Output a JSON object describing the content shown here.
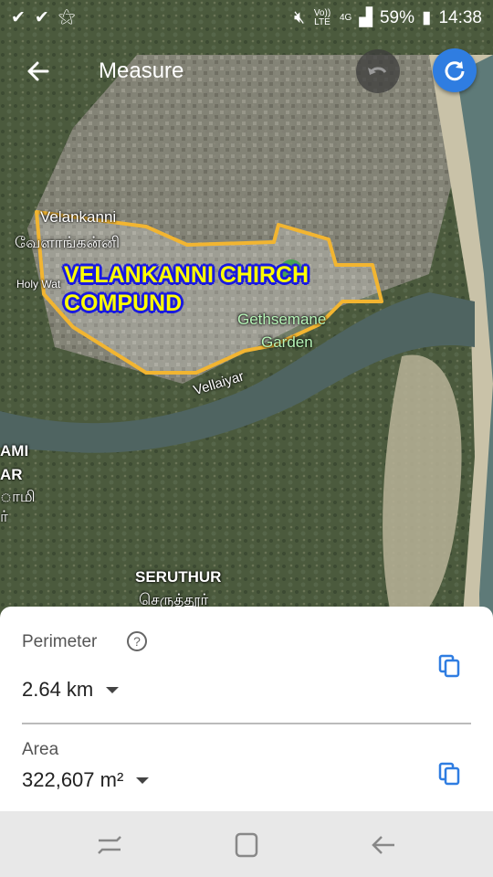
{
  "status_bar": {
    "volte_label": "Vo)) LTE",
    "network_label": "4G",
    "battery": "59%",
    "time": "14:38"
  },
  "app_bar": {
    "title": "Measure"
  },
  "map": {
    "labels": {
      "velankanni_en": "Velankanni",
      "velankanni_ta": "வேளாங்கன்னி",
      "holy_water": "Holy Wat",
      "gethsemane": "Gethsemane",
      "garden": "Garden",
      "vellaiyar": "Vellaiyar",
      "ami": "AMI",
      "ar": "AR",
      "ta_frag1": "ாமி",
      "ta_frag2": "ர்",
      "seruthur_en": "SERUTHUR",
      "seruthur_ta": "செருத்தூர்"
    },
    "callout_line1": "VELANKANNI  CHIRCH",
    "callout_line2": "COMPUND",
    "colors": {
      "polygon": "#f2b531",
      "callout_text": "#ffff00",
      "callout_outline": "#1a1ae0"
    }
  },
  "measurements": {
    "perimeter_label": "Perimeter",
    "perimeter_value": "2.64 km",
    "area_label": "Area",
    "area_value": "322,607 m²"
  },
  "icons": {
    "back": "arrow-back-icon",
    "undo": "undo-icon",
    "refresh": "refresh-icon",
    "help": "help-icon",
    "copy": "copy-icon"
  }
}
